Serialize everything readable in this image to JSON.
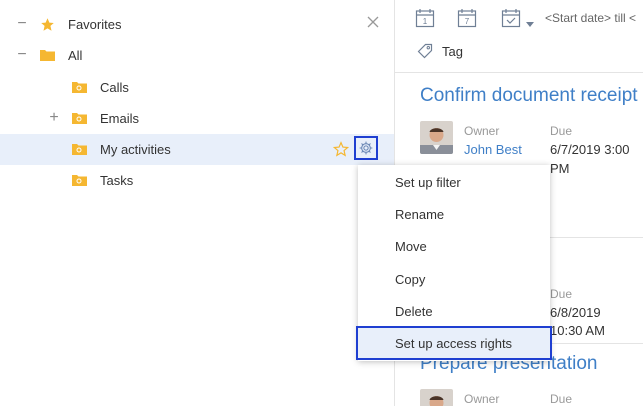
{
  "tree": {
    "favorites_label": "Favorites",
    "all_label": "All",
    "items": [
      {
        "label": "Calls"
      },
      {
        "label": "Emails"
      },
      {
        "label": "My activities"
      },
      {
        "label": "Tasks"
      }
    ]
  },
  "context_menu": {
    "items": [
      {
        "label": "Set up filter"
      },
      {
        "label": "Rename"
      },
      {
        "label": "Move"
      },
      {
        "label": "Copy"
      },
      {
        "label": "Delete"
      },
      {
        "label": "Set up access rights"
      }
    ]
  },
  "toolbar": {
    "day_label": "1",
    "week_label": "7",
    "date_range_text": "<Start date> till <"
  },
  "tag": {
    "label": "Tag"
  },
  "cards": [
    {
      "title": "Confirm document receipt",
      "owner_label": "Owner",
      "owner_name": "John Best",
      "due_label": "Due",
      "due_line1": "6/7/2019 3:00",
      "due_line2": "PM"
    },
    {
      "title_fragment": "s",
      "due_label": "Due",
      "due_line1": "6/8/2019",
      "due_line2": "10:30 AM"
    },
    {
      "title": "Prepare presentation",
      "owner_label": "Owner",
      "due_label": "Due"
    }
  ],
  "colors": {
    "accent": "#3f7fc7",
    "highlight_border": "#1f3fd1",
    "selection_bg": "#e8effa",
    "folder": "#f5b731"
  }
}
